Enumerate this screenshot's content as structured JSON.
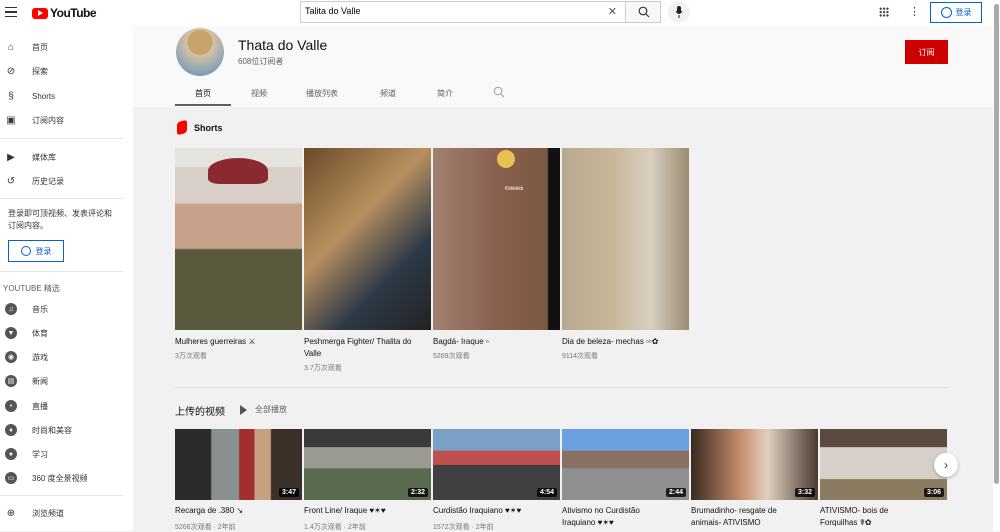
{
  "header": {
    "logo": "YouTube",
    "search_value": "Talita do Valle",
    "signin": "登录"
  },
  "sidebar": {
    "main": [
      {
        "label": "首页",
        "icon": "home-icon"
      },
      {
        "label": "探索",
        "icon": "compass-icon"
      },
      {
        "label": "Shorts",
        "icon": "shorts-icon"
      },
      {
        "label": "订阅内容",
        "icon": "subscriptions-icon"
      }
    ],
    "library": [
      {
        "label": "媒体库",
        "icon": "library-icon"
      },
      {
        "label": "历史记录",
        "icon": "history-icon"
      }
    ],
    "signin_prompt": "登录即可顶视频、发表评论和订阅内容。",
    "signin_button": "登录",
    "featured_title": "YOUTUBE 精选",
    "featured": [
      {
        "label": "音乐",
        "icon": "music-icon"
      },
      {
        "label": "体育",
        "icon": "trophy-icon"
      },
      {
        "label": "游戏",
        "icon": "gaming-icon"
      },
      {
        "label": "新闻",
        "icon": "news-icon"
      },
      {
        "label": "直播",
        "icon": "live-icon"
      },
      {
        "label": "时尚和美容",
        "icon": "fashion-icon"
      },
      {
        "label": "学习",
        "icon": "learning-icon"
      },
      {
        "label": "360 度全景视频",
        "icon": "360-icon"
      }
    ],
    "browse": "浏览频道"
  },
  "channel": {
    "name": "Thata do Valle",
    "subscribers": "608位订阅者",
    "subscribe": "订阅",
    "tabs": [
      "首页",
      "视频",
      "播放列表",
      "频道",
      "简介"
    ]
  },
  "shorts": {
    "title": "Shorts",
    "items": [
      {
        "title": "Mulheres guerreiras ⚔",
        "views": "3万次观看"
      },
      {
        "title": "Peshmerga Fighter/ Thalita do Valle",
        "views": "3.7万次观看"
      },
      {
        "title": "Bagdá- Iraque ▫",
        "views": "5269次观看",
        "overlay": "Kkkkkkk"
      },
      {
        "title": "Dia de beleza- mechas ▫▫✿",
        "views": "9114次观看"
      }
    ]
  },
  "uploads": {
    "title": "上传的视频",
    "play_all": "全部播放",
    "items": [
      {
        "title": "Recarga de .380 ↘",
        "meta": "5266次观看 · 2年前",
        "duration": "3:47"
      },
      {
        "title": "Front Line/ Iraque ♥✶♥",
        "meta": "1.4万次观看 · 2年前",
        "duration": "2:32"
      },
      {
        "title": "Curdistão Iraquiano ♥✶♥",
        "meta": "1572次观看 · 2年前",
        "duration": "4:54"
      },
      {
        "title": "Ativismo no Curdistão Iraquiano ♥✶♥",
        "meta": "",
        "duration": "2:44"
      },
      {
        "title": "Brumadinho- resgate de animais- ATIVISMO",
        "meta": "",
        "duration": "3:32"
      },
      {
        "title": "ATIVISMO- bois de Forquilhas ☤✿",
        "meta": "",
        "duration": "3:06"
      }
    ]
  },
  "colors": {
    "brand": "#ff0000",
    "subscribe": "#cc0000",
    "link": "#065fd4"
  }
}
